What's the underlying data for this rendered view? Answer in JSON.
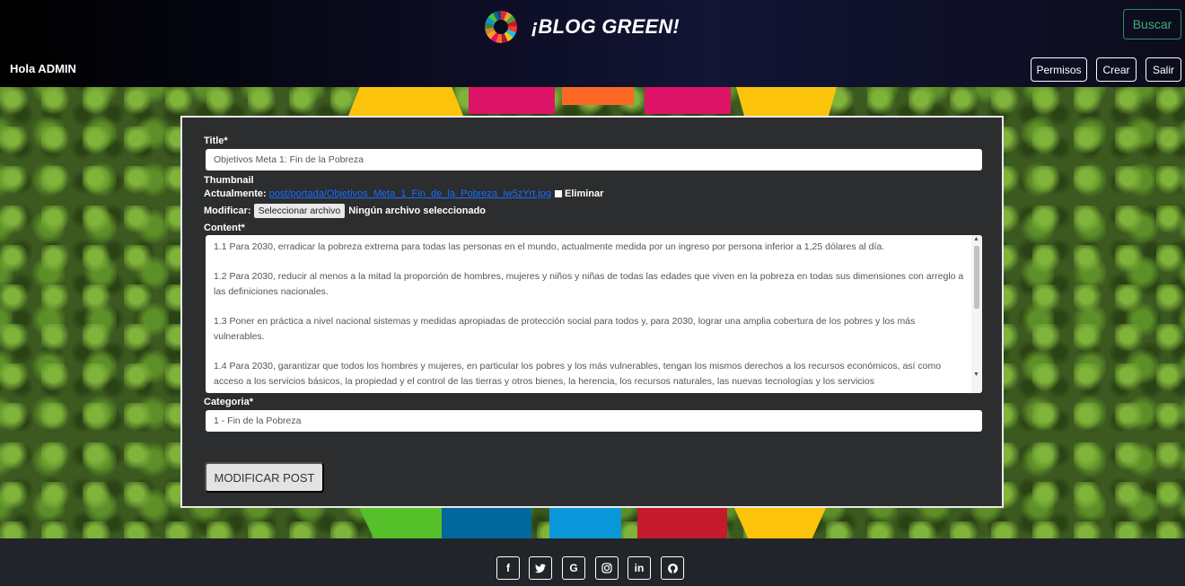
{
  "header": {
    "brand_title": "¡BLOG GREEN!",
    "search_label": "Buscar",
    "greeting": "Hola ADMIN",
    "nav": {
      "permisos": "Permisos",
      "crear": "Crear",
      "salir": "Salir"
    }
  },
  "form": {
    "title_label": "Title*",
    "title_value": "Objetivos Meta 1: Fin de la Pobreza",
    "thumbnail_label": "Thumbnail",
    "current_label": "Actualmente:",
    "current_link": "post/portada/Objetivos_Meta_1_Fin_de_la_Pobreza_iw5zYrt.jpg",
    "delete_label": "Eliminar",
    "modify_label": "Modificar:",
    "file_button": "Seleccionar archivo",
    "file_status": "Ningún archivo seleccionado",
    "content_label": "Content*",
    "content_paragraphs": [
      "1.1  Para 2030, erradicar la pobreza extrema para todas las personas en el mundo, actualmente medida por un ingreso por persona inferior a 1,25 dólares al día.",
      "1.2  Para 2030, reducir al menos a la mitad la proporción de hombres, mujeres y niños y niñas de todas las edades que viven en la pobreza en todas sus dimensiones con arreglo a las definiciones nacionales.",
      "1.3   Poner en práctica a nivel nacional sistemas y medidas apropiadas de protección social para todos y, para 2030, lograr una amplia cobertura de los pobres y los más vulnerables.",
      "1.4   Para 2030, garantizar que todos los hombres y mujeres, en particular los pobres y los más vulnerables, tengan los mismos derechos a los recursos económicos, así como acceso a los servicios básicos, la propiedad y el control de las tierras y otros bienes, la herencia, los recursos naturales, las nuevas tecnologías y los servicios"
    ],
    "category_label": "Categoria*",
    "category_value": "1 - Fin de la Pobreza",
    "submit_label": "MODIFICAR POST"
  },
  "footer": {
    "social_icons": [
      "facebook-icon",
      "twitter-icon",
      "google-icon",
      "instagram-icon",
      "linkedin-icon",
      "github-icon"
    ]
  },
  "colors": {
    "accent_green": "#3fae78",
    "link_blue": "#1a6cff",
    "card_bg": "#2b2d2e",
    "footer_bg": "#212529"
  }
}
